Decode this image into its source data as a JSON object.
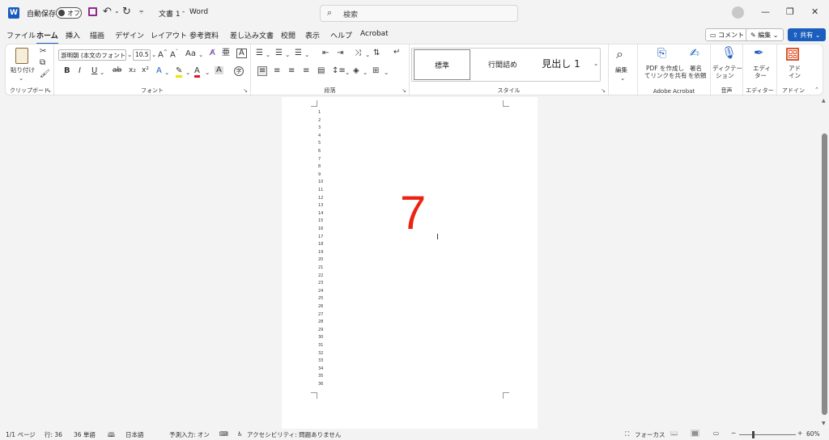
{
  "titlebar": {
    "autosave_label": "自動保存",
    "autosave_state": "オフ",
    "doc_title": "文書 1",
    "separator": "-",
    "app_name": "Word",
    "search_placeholder": "検索"
  },
  "menu": {
    "items": [
      "ファイル",
      "ホーム",
      "挿入",
      "描画",
      "デザイン",
      "レイアウト",
      "参考資料",
      "差し込み文書",
      "校閲",
      "表示",
      "ヘルプ",
      "Acrobat"
    ],
    "active": "ホーム",
    "comment_label": "コメント",
    "edit_label": "編集",
    "share_label": "共有"
  },
  "ribbon": {
    "clipboard": {
      "paste_label": "貼り付け",
      "group_label": "クリップボード"
    },
    "font": {
      "font_name": "游明朝 (本文のフォント",
      "font_size": "10.5",
      "group_label": "フォント",
      "case_label": "Aa"
    },
    "paragraph": {
      "group_label": "段落"
    },
    "styles": {
      "items": [
        "標準",
        "行間詰め",
        "見出し 1"
      ],
      "group_label": "スタイル"
    },
    "editing": {
      "label": "編集"
    },
    "adobe": {
      "create_pdf": "PDF を作成し",
      "create_pdf2": "てリンクを共有",
      "sign": "署名",
      "sign2": "を依頼",
      "group_label": "Adobe Acrobat"
    },
    "voice": {
      "dictation": "ディクテー",
      "dictation2": "ション",
      "group_label": "音声"
    },
    "editor": {
      "label": "エディ",
      "label2": "ター",
      "group_label": "エディター"
    },
    "addins": {
      "label": "アド",
      "label2": "イン",
      "group_label": "アドイン"
    }
  },
  "document": {
    "line_numbers": [
      "1",
      "2",
      "3",
      "4",
      "5",
      "6",
      "7",
      "8",
      "9",
      "10",
      "11",
      "12",
      "13",
      "14",
      "15",
      "16",
      "17",
      "18",
      "19",
      "20",
      "21",
      "22",
      "23",
      "24",
      "25",
      "26",
      "27",
      "28",
      "29",
      "30",
      "31",
      "32",
      "33",
      "34",
      "35",
      "36"
    ],
    "big_text": "7",
    "big_text_color": "#ee2211"
  },
  "status": {
    "page": "1/1 ページ",
    "line": "行: 36",
    "words": "36 単語",
    "language": "日本語",
    "predictive": "予測入力: オン",
    "accessibility": "アクセシビリティ: 問題ありません",
    "focus": "フォーカス",
    "zoom": "60%"
  },
  "colors": {
    "accent": "#1b5ebe",
    "word_blue": "#185abd"
  }
}
